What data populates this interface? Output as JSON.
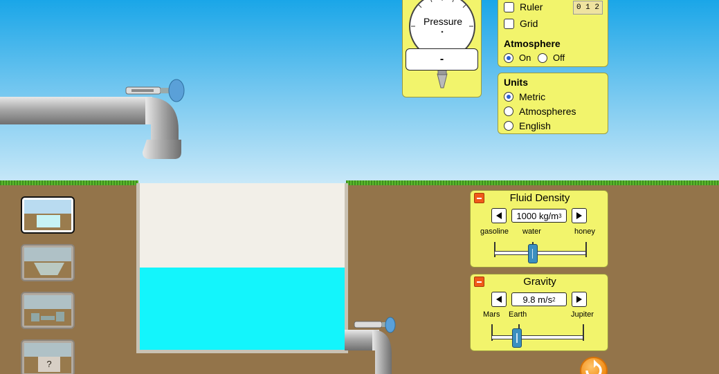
{
  "controls": {
    "ruler_label": "Ruler",
    "grid_label": "Grid",
    "ruler_icon_text": "0 1 2",
    "atmosphere": {
      "title": "Atmosphere",
      "on_label": "On",
      "off_label": "Off",
      "selected": "On"
    }
  },
  "units": {
    "title": "Units",
    "options": [
      "Metric",
      "Atmospheres",
      "English"
    ],
    "selected": "Metric"
  },
  "gauge": {
    "label": "Pressure",
    "readout": "-"
  },
  "fluid_density": {
    "title": "Fluid Density",
    "value": "1000 kg/m",
    "unit_exponent": "3",
    "ticks": [
      "gasoline",
      "water",
      "honey"
    ],
    "slider_fraction": 0.42
  },
  "gravity": {
    "title": "Gravity",
    "value": "9.8 m/s",
    "unit_exponent": "2",
    "ticks": [
      "Mars",
      "Earth",
      "Jupiter"
    ],
    "slider_fraction": 0.28
  },
  "scenes": {
    "mystery_label": "?"
  },
  "colors": {
    "water": "#13f5fc",
    "panel": "#f2f46c",
    "ground": "#93744a",
    "air": "#f2efe8"
  }
}
